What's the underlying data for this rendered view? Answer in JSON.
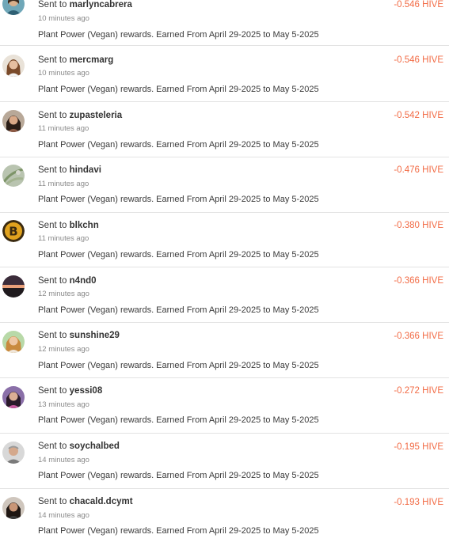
{
  "colors": {
    "amount": "#f26b45",
    "divider": "#e3e3e3"
  },
  "transfers": [
    {
      "prefix": "Sent to",
      "user": "marlyncabrera",
      "time": "10 minutes ago",
      "memo": "Plant Power (Vegan) rewards. Earned From April 29-2025 to May 5-2025",
      "amount": "-0.546 HIVE",
      "avatar": "avatar-woman-teal"
    },
    {
      "prefix": "Sent to",
      "user": "mercmarg",
      "time": "10 minutes ago",
      "memo": "Plant Power (Vegan) rewards. Earned From April 29-2025 to May 5-2025",
      "amount": "-0.546 HIVE",
      "avatar": "avatar-woman-light"
    },
    {
      "prefix": "Sent to",
      "user": "zupasteleria",
      "time": "11 minutes ago",
      "memo": "Plant Power (Vegan) rewards. Earned From April 29-2025 to May 5-2025",
      "amount": "-0.542 HIVE",
      "avatar": "avatar-woman-dark-hair"
    },
    {
      "prefix": "Sent to",
      "user": "hindavi",
      "time": "11 minutes ago",
      "memo": "Plant Power (Vegan) rewards. Earned From April 29-2025 to May 5-2025",
      "amount": "-0.476 HIVE",
      "avatar": "avatar-plant"
    },
    {
      "prefix": "Sent to",
      "user": "blkchn",
      "time": "11 minutes ago",
      "memo": "Plant Power (Vegan) rewards. Earned From April 29-2025 to May 5-2025",
      "amount": "-0.380 HIVE",
      "avatar": "avatar-bitcoin"
    },
    {
      "prefix": "Sent to",
      "user": "n4nd0",
      "time": "12 minutes ago",
      "memo": "Plant Power (Vegan) rewards. Earned From April 29-2025 to May 5-2025",
      "amount": "-0.366 HIVE",
      "avatar": "avatar-sunset"
    },
    {
      "prefix": "Sent to",
      "user": "sunshine29",
      "time": "12 minutes ago",
      "memo": "Plant Power (Vegan) rewards. Earned From April 29-2025 to May 5-2025",
      "amount": "-0.366 HIVE",
      "avatar": "avatar-woman-blonde"
    },
    {
      "prefix": "Sent to",
      "user": "yessi08",
      "time": "13 minutes ago",
      "memo": "Plant Power (Vegan) rewards. Earned From April 29-2025 to May 5-2025",
      "amount": "-0.272 HIVE",
      "avatar": "avatar-woman-purple"
    },
    {
      "prefix": "Sent to",
      "user": "soychalbed",
      "time": "14 minutes ago",
      "memo": "Plant Power (Vegan) rewards. Earned From April 29-2025 to May 5-2025",
      "amount": "-0.195 HIVE",
      "avatar": "avatar-man-gray"
    },
    {
      "prefix": "Sent to",
      "user": "chacald.dcymt",
      "time": "14 minutes ago",
      "memo": "Plant Power (Vegan) rewards. Earned From April 29-2025 to May 5-2025",
      "amount": "-0.193 HIVE",
      "avatar": "avatar-woman-dark"
    }
  ]
}
